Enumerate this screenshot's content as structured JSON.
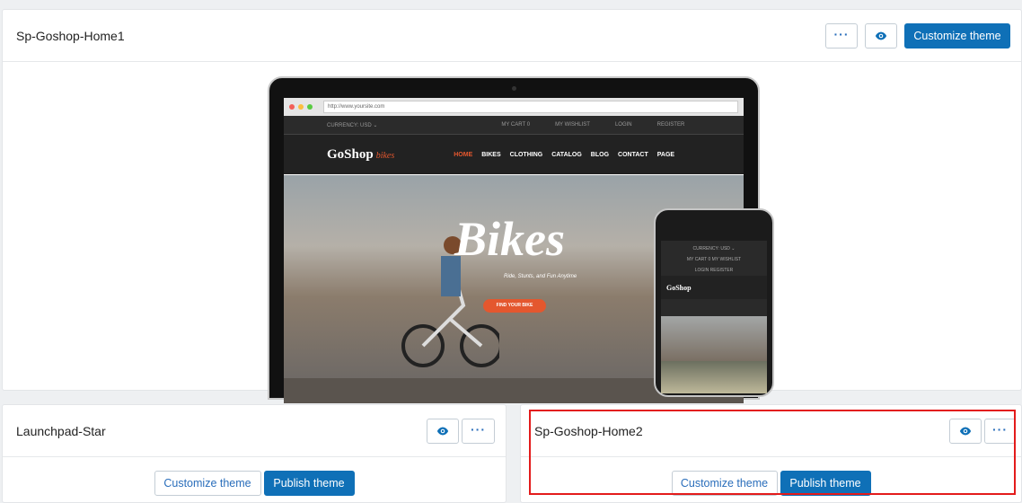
{
  "main_theme": {
    "name": "Sp-Goshop-Home1",
    "more_label": "···",
    "customize_label": "Customize theme",
    "preview": {
      "url": "http://www.yoursite.com",
      "topbar": [
        "CURRENCY:  USD ⌄",
        "MY CART  0",
        "MY WISHLIST",
        "LOGIN",
        "REGISTER"
      ],
      "logo": "GoShop",
      "logo_suffix": "bikes",
      "menu": [
        "HOME",
        "BIKES",
        "CLOTHING",
        "CATALOG",
        "BLOG",
        "CONTACT",
        "PAGE"
      ],
      "hero_title": "Bikes",
      "hero_subtitle": "Ride, Stunts, and Fun Anytime",
      "hero_button": "FIND YOUR BIKE",
      "mobile_rows": [
        "CURRENCY:  USD ⌄",
        "MY CART  0     MY WISHLIST",
        "LOGIN     REGISTER"
      ],
      "mobile_logo": "GoShop"
    }
  },
  "library": [
    {
      "name": "Launchpad-Star",
      "more_label": "···",
      "customize_label": "Customize theme",
      "publish_label": "Publish theme"
    },
    {
      "name": "Sp-Goshop-Home2",
      "more_label": "···",
      "customize_label": "Customize theme",
      "publish_label": "Publish theme"
    }
  ],
  "colors": {
    "primary": "#0f70b7",
    "highlight": "#e31b1b"
  }
}
